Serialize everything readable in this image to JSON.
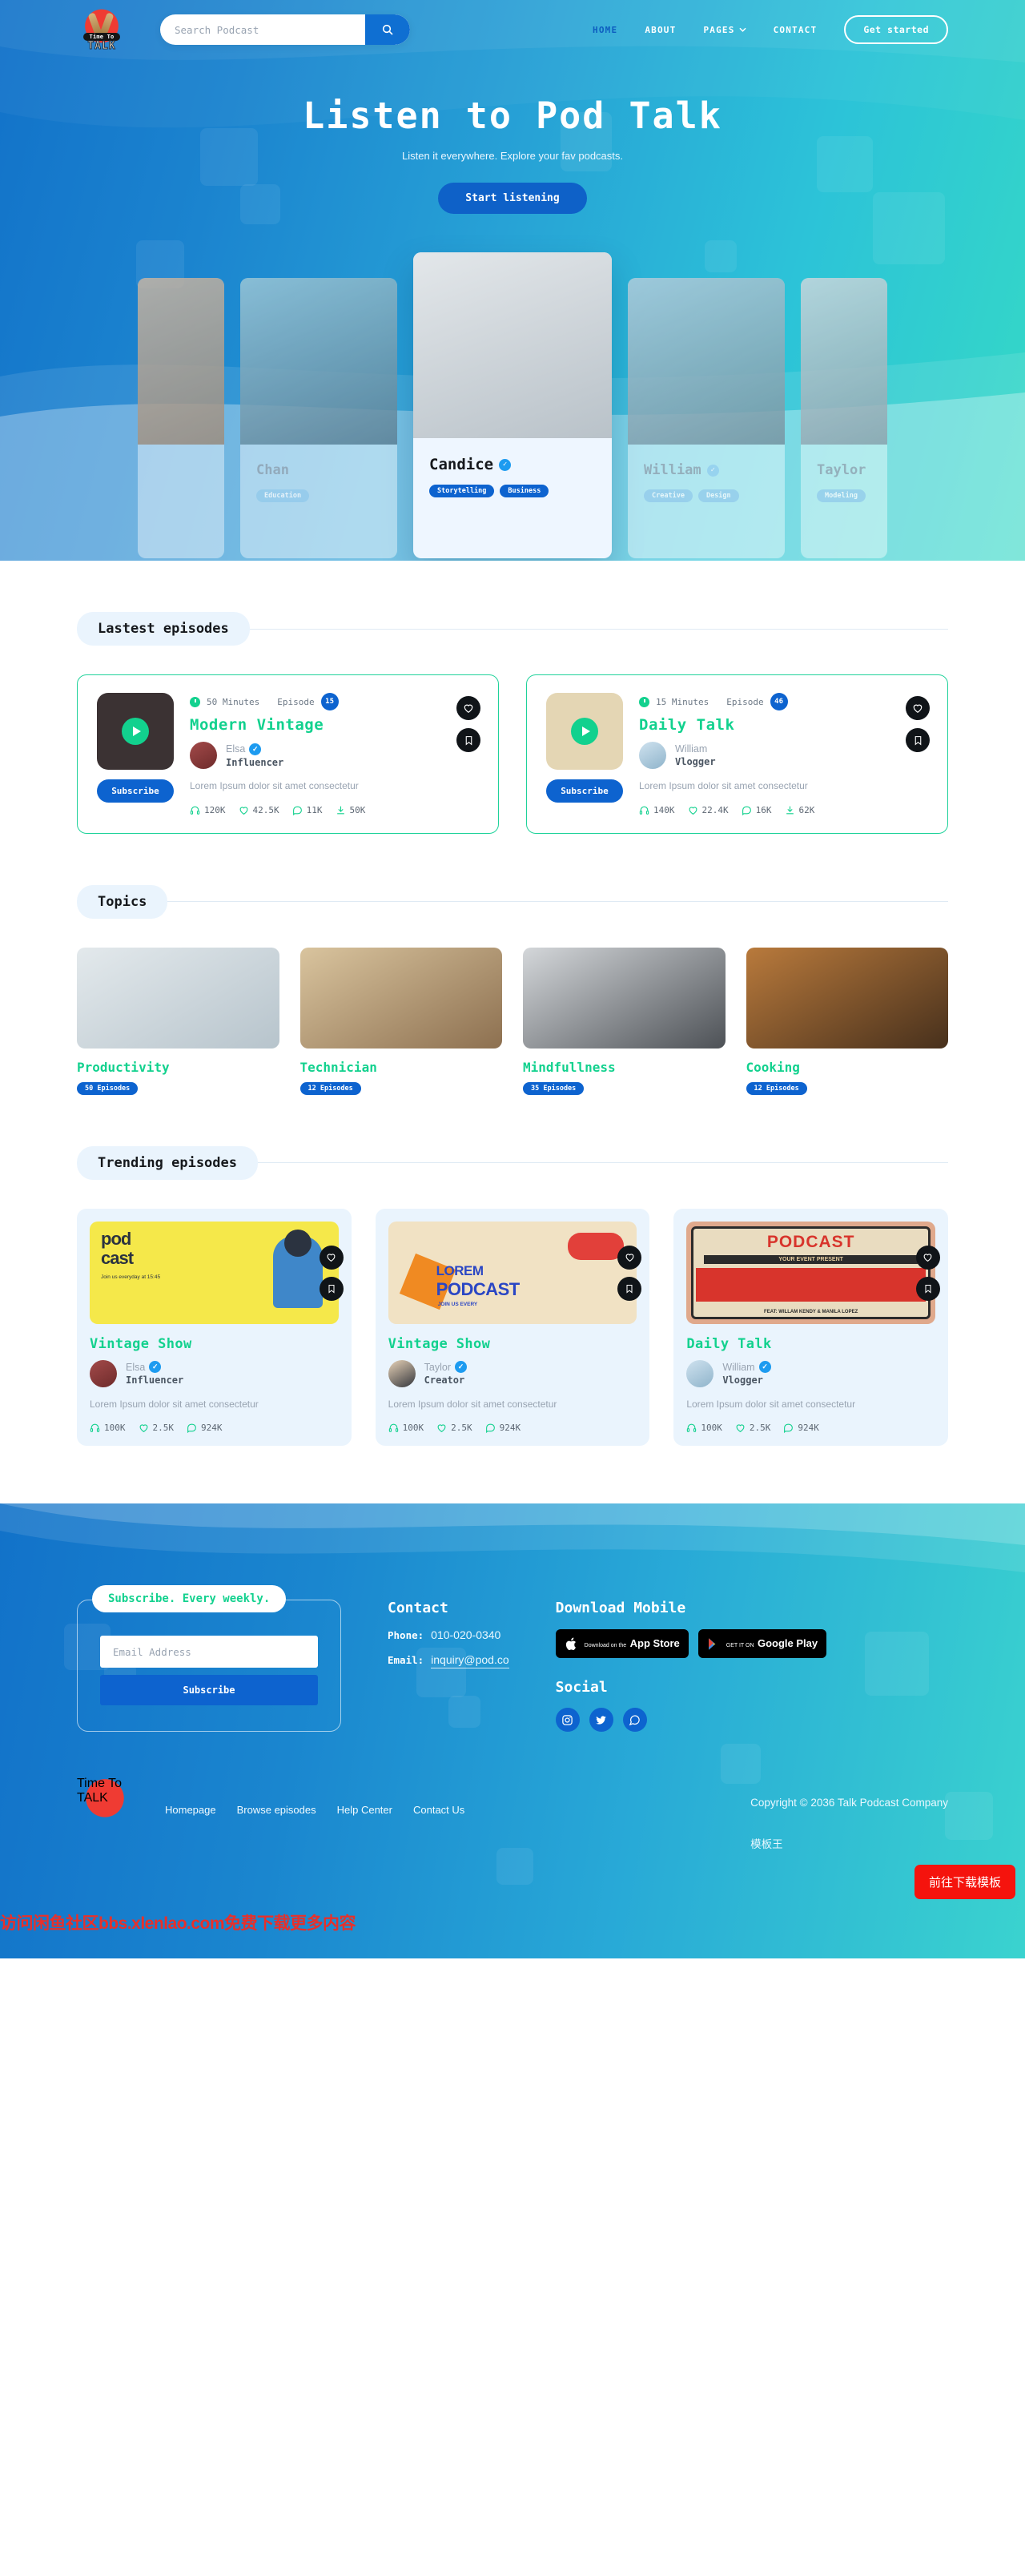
{
  "brand": {
    "logo_line1": "Time To",
    "logo_line2": "TALK"
  },
  "search": {
    "placeholder": "Search Podcast",
    "value": "",
    "icon": "search-icon"
  },
  "nav": {
    "items": [
      {
        "label": "HOME",
        "active": true
      },
      {
        "label": "ABOUT",
        "active": false
      },
      {
        "label": "PAGES",
        "active": false,
        "caret": "⌄"
      },
      {
        "label": "CONTACT",
        "active": false
      }
    ],
    "cta": "Get started"
  },
  "hero": {
    "title": "Listen to Pod Talk",
    "subtitle": "Listen it everywhere. Explore your fav podcasts.",
    "button": "Start listening"
  },
  "carousel": {
    "cards": [
      {
        "name": "",
        "tags": [],
        "clip": true
      },
      {
        "name": "Chan",
        "tags": [
          "Education"
        ],
        "verified": false
      },
      {
        "name": "Candice",
        "tags": [
          "Storytelling",
          "Business"
        ],
        "verified": true,
        "active": true
      },
      {
        "name": "William",
        "tags": [
          "Creative",
          "Design"
        ],
        "verified": true
      },
      {
        "name": "Taylor",
        "tags": [
          "Modeling"
        ],
        "verified": true,
        "clip": true
      }
    ],
    "dots": [
      true,
      false,
      false,
      false,
      false
    ]
  },
  "latest": {
    "heading": "Lastest episodes",
    "subscribe_label": "Subscribe",
    "episode_label": "Episode",
    "episodes": [
      {
        "duration": "50 Minutes",
        "number": "15",
        "title": "Modern Vintage",
        "author": "Elsa",
        "role": "Influencer",
        "verified": true,
        "description": "Lorem Ipsum dolor sit amet consectetur",
        "stats": [
          {
            "icon": "headphones-icon",
            "value": "120K"
          },
          {
            "icon": "heart-icon",
            "value": "42.5K"
          },
          {
            "icon": "comment-icon",
            "value": "11K"
          },
          {
            "icon": "download-icon",
            "value": "50K"
          }
        ]
      },
      {
        "duration": "15 Minutes",
        "number": "46",
        "title": "Daily Talk",
        "author": "William",
        "role": "Vlogger",
        "verified": false,
        "description": "Lorem Ipsum dolor sit amet consectetur",
        "stats": [
          {
            "icon": "headphones-icon",
            "value": "140K"
          },
          {
            "icon": "heart-icon",
            "value": "22.4K"
          },
          {
            "icon": "comment-icon",
            "value": "16K"
          },
          {
            "icon": "download-icon",
            "value": "62K"
          }
        ]
      }
    ]
  },
  "topics": {
    "heading": "Topics",
    "items": [
      {
        "name": "Productivity",
        "count": "50 Episodes"
      },
      {
        "name": "Technician",
        "count": "12 Episodes"
      },
      {
        "name": "Mindfullness",
        "count": "35 Episodes"
      },
      {
        "name": "Cooking",
        "count": "12 Episodes"
      }
    ]
  },
  "trending": {
    "heading": "Trending episodes",
    "cards": [
      {
        "art_text_1": "pod",
        "art_text_2": "cast",
        "art_caption": "Join us everyday at 15:45",
        "title": "Vintage Show",
        "author": "Elsa",
        "role": "Influencer",
        "verified": true,
        "description": "Lorem Ipsum dolor sit amet consectetur",
        "stats": [
          {
            "icon": "headphones-icon",
            "value": "100K"
          },
          {
            "icon": "heart-icon",
            "value": "2.5K"
          },
          {
            "icon": "comment-icon",
            "value": "924K"
          }
        ]
      },
      {
        "art_text_1": "LOREM",
        "art_text_2": "PODCAST",
        "art_caption": "JOIN US EVERY",
        "title": "Vintage Show",
        "author": "Taylor",
        "role": "Creator",
        "verified": true,
        "description": "Lorem Ipsum dolor sit amet consectetur",
        "stats": [
          {
            "icon": "headphones-icon",
            "value": "100K"
          },
          {
            "icon": "heart-icon",
            "value": "2.5K"
          },
          {
            "icon": "comment-icon",
            "value": "924K"
          }
        ]
      },
      {
        "art_text_1": "PODCAST",
        "art_text_2": "YOUR EVENT PRESENT",
        "art_caption": "FEAT: WILLAM KENDY & MANILA LOPEZ",
        "title": "Daily Talk",
        "author": "William",
        "role": "Vlogger",
        "verified": true,
        "description": "Lorem Ipsum dolor sit amet consectetur",
        "stats": [
          {
            "icon": "headphones-icon",
            "value": "100K"
          },
          {
            "icon": "heart-icon",
            "value": "2.5K"
          },
          {
            "icon": "comment-icon",
            "value": "924K"
          }
        ]
      }
    ]
  },
  "footer": {
    "newsletter": {
      "pill": "Subscribe. Every weekly.",
      "placeholder": "Email Address",
      "value": "",
      "button": "Subscribe"
    },
    "contact": {
      "title": "Contact",
      "phone_label": "Phone:",
      "phone": "010-020-0340",
      "email_label": "Email:",
      "email": "inquiry@pod.co"
    },
    "download": {
      "title": "Download Mobile",
      "apple_small": "Download on the",
      "apple_big": "App Store",
      "google_small": "GET IT ON",
      "google_big": "Google Play"
    },
    "social": {
      "title": "Social",
      "items": [
        "instagram-icon",
        "twitter-icon",
        "whatsapp-icon"
      ]
    },
    "links": [
      "Homepage",
      "Browse episodes",
      "Help Center",
      "Contact Us"
    ],
    "copyright": "Copyright © 2036 Talk Podcast Company",
    "cn_text": "模板王"
  },
  "overlay": {
    "watermark": "访问闲鱼社区bbs.xlenlao.com免费下载更多内容",
    "download_button": "前往下载模板"
  },
  "colors": {
    "blue": "#0d63cf",
    "green": "#12d18e",
    "cyan": "#3ad3cf",
    "red": "#f5130d"
  }
}
